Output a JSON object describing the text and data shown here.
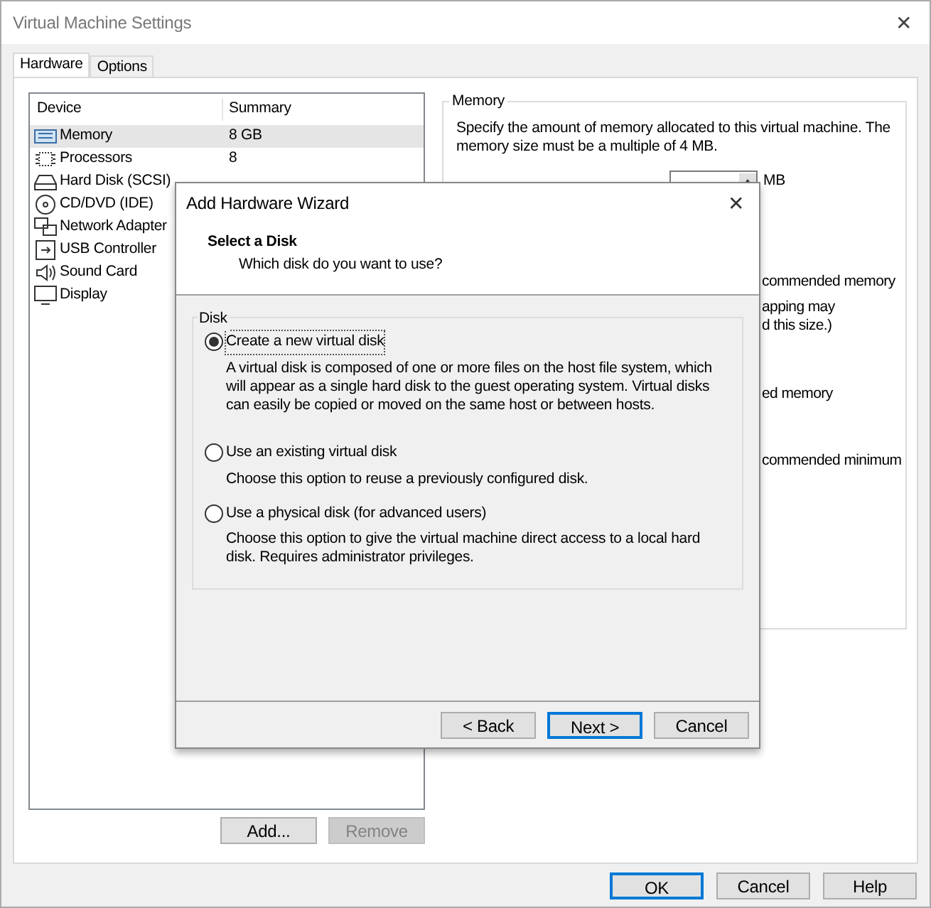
{
  "window": {
    "title": "Virtual Machine Settings",
    "close": "✕"
  },
  "tabs": [
    {
      "label": "Hardware",
      "selected": true
    },
    {
      "label": "Options",
      "selected": false
    }
  ],
  "devices": {
    "columns": [
      "Device",
      "Summary"
    ],
    "rows": [
      {
        "kind": "memory",
        "device": "Memory",
        "summary": "8 GB",
        "selected": true
      },
      {
        "kind": "processor",
        "device": "Processors",
        "summary": "8",
        "selected": false
      },
      {
        "kind": "disk",
        "device": "Hard Disk (SCSI)",
        "selected": false
      },
      {
        "kind": "cd",
        "device": "CD/DVD (IDE)",
        "selected": false
      },
      {
        "kind": "network",
        "device": "Network Adapter",
        "selected": false
      },
      {
        "kind": "usb",
        "device": "USB Controller",
        "selected": false
      },
      {
        "kind": "sound",
        "device": "Sound Card",
        "selected": false
      },
      {
        "kind": "display",
        "device": "Display",
        "selected": false
      }
    ]
  },
  "device_buttons": [
    {
      "label": "Add...",
      "disabled": false
    },
    {
      "label": "Remove",
      "disabled": true
    }
  ],
  "memory": {
    "title": "Memory",
    "description": "Specify the amount of memory allocated to this virtual machine. The memory size must be a multiple of 4 MB.",
    "unit": "MB",
    "fragments": [
      [
        "commended memory"
      ],
      [
        "apping may",
        "d this size.)"
      ],
      [
        "ed memory"
      ],
      [
        "commended minimum"
      ]
    ]
  },
  "buttons": [
    {
      "label": "OK",
      "default": true
    },
    {
      "label": "Cancel",
      "default": false
    },
    {
      "label": "Help",
      "default": false
    }
  ],
  "wizard": {
    "title": "Add Hardware Wizard",
    "close": "✕",
    "heading": "Select a Disk",
    "subheading": "Which disk do you want to use?",
    "group": "Disk",
    "options": [
      {
        "label": "Create a new virtual disk",
        "description": "A virtual disk is composed of one or more files on the host file system, which will appear as a single hard disk to the guest operating system. Virtual disks can easily be copied or moved on the same host or between hosts.",
        "selected": true
      },
      {
        "label": "Use an existing virtual disk",
        "description": "Choose this option to reuse a previously configured disk.",
        "selected": false
      },
      {
        "label": "Use a physical disk (for advanced users)",
        "description": "Choose this option to give the virtual machine direct access to a local hard disk. Requires administrator privileges.",
        "selected": false
      }
    ],
    "buttons": [
      {
        "label": "< Back",
        "default": false
      },
      {
        "label": "Next >",
        "default": true
      },
      {
        "label": "Cancel",
        "default": false
      }
    ]
  }
}
